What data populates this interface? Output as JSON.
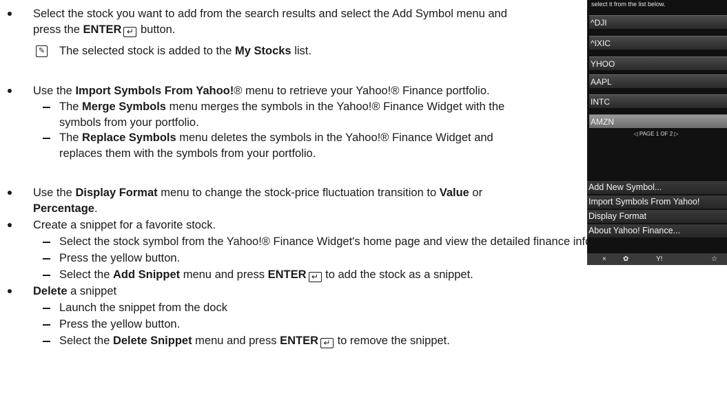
{
  "body": {
    "b1": {
      "pre": "Select the stock you want to add from the search results and select the Add Symbol menu and",
      "l2_pre": "press the ",
      "l2_bold": "ENTER",
      "l2_post": " button."
    },
    "note1": {
      "pre": "The selected stock is added to the ",
      "bold": "My Stocks",
      "post": " list."
    },
    "b2": {
      "pre": "Use the ",
      "bold": "Import Symbols From Yahoo!",
      "post": "® menu to retrieve your Yahoo!® Finance portfolio.",
      "d1_pre": "The ",
      "d1_bold": "Merge Symbols",
      "d1_post": " menu merges the symbols in the Yahoo!® Finance Widget with the",
      "d1_l2": "symbols from your portfolio.",
      "d2_pre": "The ",
      "d2_bold": "Replace Symbols",
      "d2_post": " menu deletes the symbols in the Yahoo!® Finance Widget and",
      "d2_l2": "replaces them with the symbols from your portfolio."
    },
    "b3": {
      "pre": "Use the ",
      "bold": "Display Format",
      "mid": " menu to change the stock-price fluctuation transition to ",
      "bold2": "Value",
      "post": " or",
      "l2_bold": "Percentage",
      "l2_post": "."
    },
    "b4": {
      "text": "Create a snippet for a favorite stock.",
      "d1": "Select the stock symbol from the Yahoo!® Finance Widget's home page and view the detailed finance information.",
      "d2": "Press the yellow button.",
      "d3_pre": "Select the ",
      "d3_bold": "Add Snippet",
      "d3_mid": " menu and press ",
      "d3_bold2": "ENTER",
      "d3_post": " to add the stock as a snippet."
    },
    "b5": {
      "bold": "Delete",
      "post": " a snippet",
      "d1": "Launch the snippet from the dock",
      "d2": "Press the yellow button.",
      "d3_pre": "Select the ",
      "d3_bold": "Delete Snippet",
      "d3_mid": " menu and press ",
      "d3_bold2": "ENTER",
      "d3_post": " to remove the snippet."
    }
  },
  "panel": {
    "hint": "select it from the list below.",
    "symbols": [
      "^DJI",
      "^IXIC",
      "YHOO",
      "AAPL",
      "INTC",
      "AMZN"
    ],
    "selected": "AMZN",
    "pager": "◁  PAGE 1 OF 2  ▷",
    "menu": [
      "Add New Symbol...",
      "Import Symbols From Yahoo!",
      "Display Format",
      "About Yahoo! Finance..."
    ],
    "dock": [
      "×",
      "✿",
      "Y!",
      "☆"
    ]
  },
  "icons": {
    "enter": "enter-icon",
    "note": "note-icon",
    "bullet": "bullet-icon"
  }
}
